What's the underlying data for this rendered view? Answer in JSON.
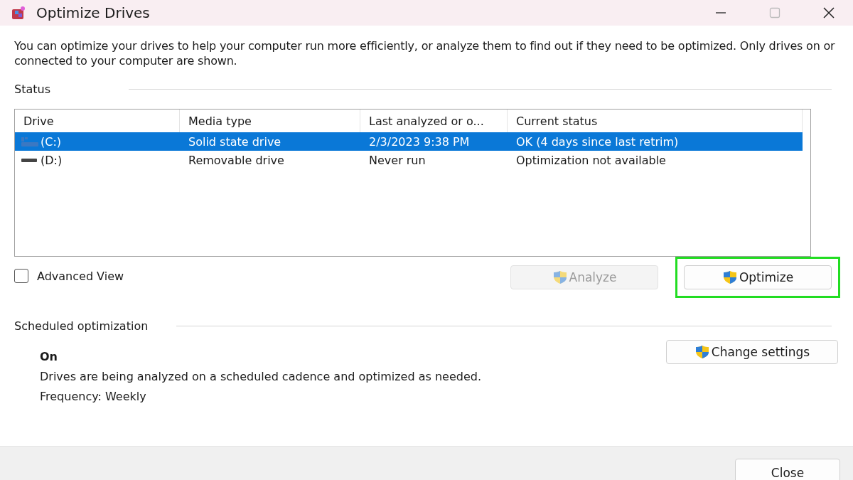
{
  "window": {
    "title": "Optimize Drives"
  },
  "intro": "You can optimize your drives to help your computer run more efficiently, or analyze them to find out if they need to be optimized. Only drives on or connected to your computer are shown.",
  "status": {
    "heading": "Status",
    "columns": [
      "Drive",
      "Media type",
      "Last analyzed or o...",
      "Current status"
    ],
    "rows": [
      {
        "kind": "ssd",
        "drive": "(C:)",
        "media_type": "Solid state drive",
        "last_analyzed": "2/3/2023 9:38 PM",
        "current_status": "OK (4 days since last retrim)",
        "selected": true
      },
      {
        "kind": "removable",
        "drive": "(D:)",
        "media_type": "Removable drive",
        "last_analyzed": "Never run",
        "current_status": "Optimization not available",
        "selected": false
      }
    ]
  },
  "advanced_view": {
    "label": "Advanced View",
    "checked": false
  },
  "actions": [
    {
      "label": "Analyze",
      "disabled": true,
      "highlighted": false
    },
    {
      "label": "Optimize",
      "disabled": false,
      "highlighted": true
    }
  ],
  "scheduled": {
    "heading": "Scheduled optimization",
    "state": "On",
    "description": "Drives are being analyzed on a scheduled cadence and optimized as needed.",
    "frequency": "Frequency: Weekly",
    "button": "Change settings"
  },
  "footer": {
    "button": "Close"
  }
}
